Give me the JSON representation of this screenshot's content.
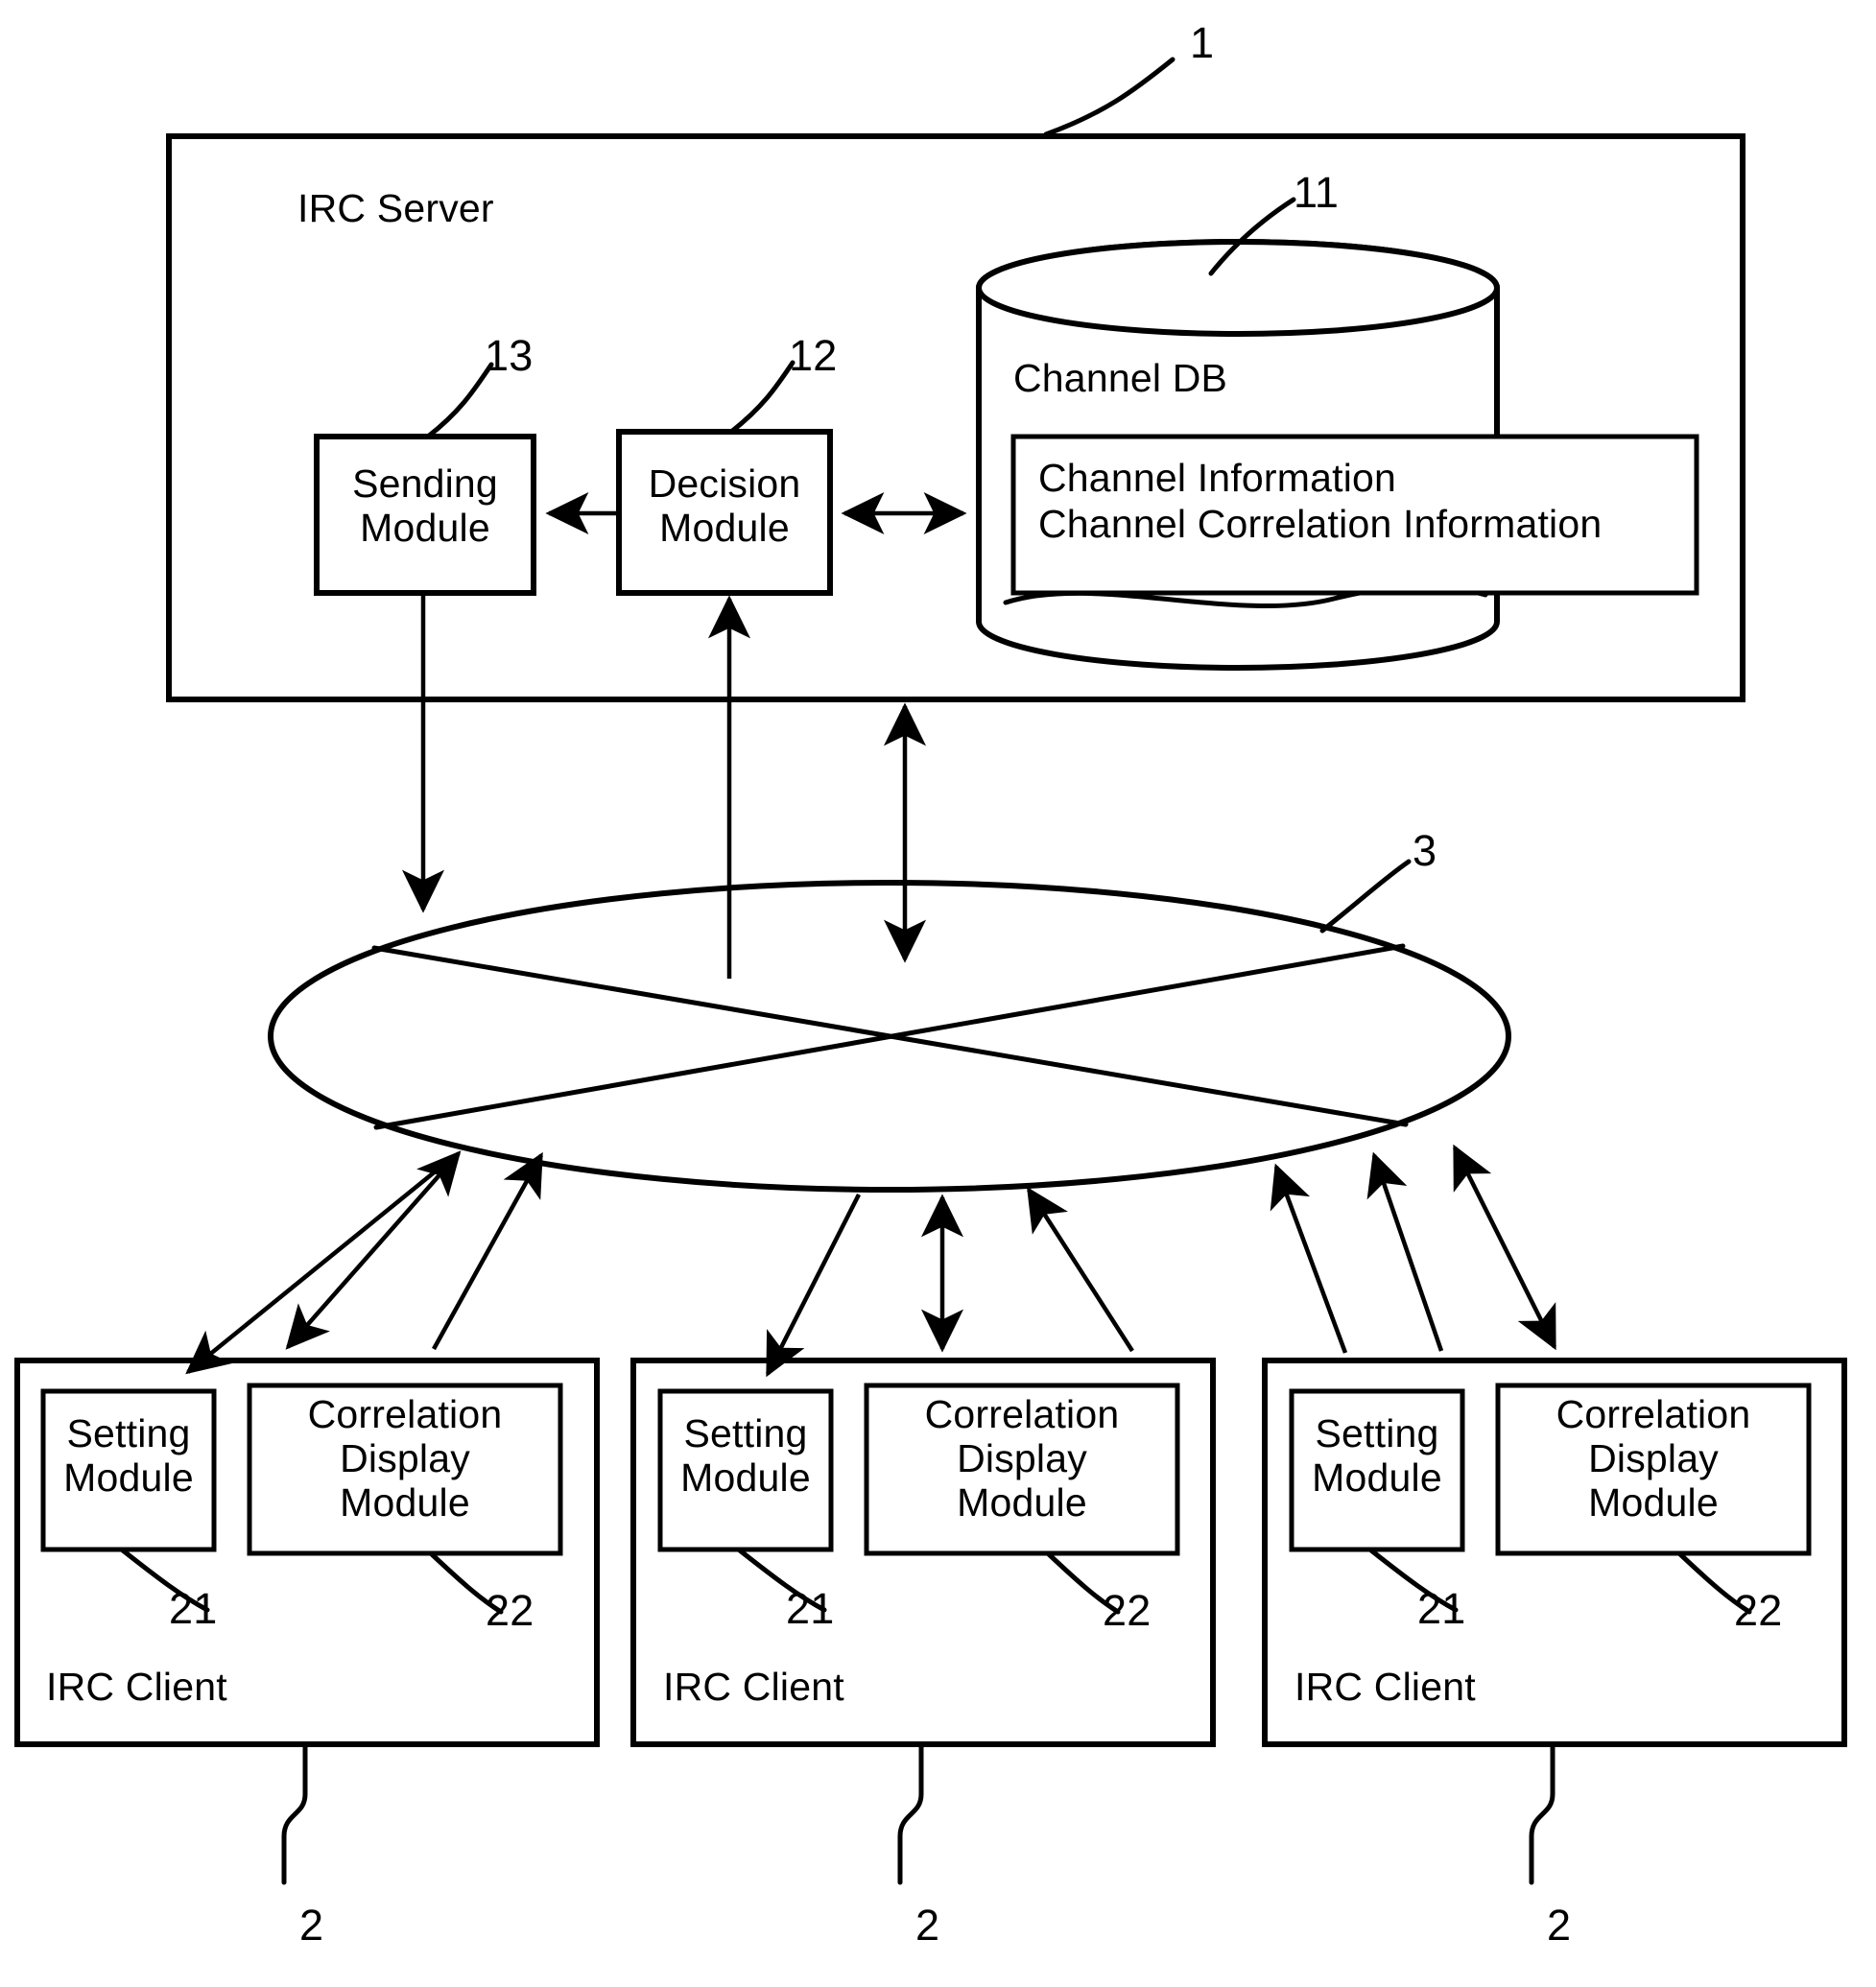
{
  "figure": {
    "server": {
      "label": "IRC Server",
      "ref": "1",
      "sending_module": {
        "line1": "Sending",
        "line2": "Module",
        "ref": "13"
      },
      "decision_module": {
        "line1": "Decision",
        "line2": "Module",
        "ref": "12"
      },
      "channel_db": {
        "label": "Channel DB",
        "ref": "11",
        "info_line1": "Channel Information",
        "info_line2": "Channel Correlation Information"
      }
    },
    "network": {
      "ref": "3"
    },
    "clients": [
      {
        "label": "IRC Client",
        "ref": "2",
        "setting_module": {
          "line1": "Setting",
          "line2": "Module",
          "ref": "21"
        },
        "correlation_display_module": {
          "line1": "Correlation",
          "line2": "Display",
          "line3": "Module",
          "ref": "22"
        }
      },
      {
        "label": "IRC Client",
        "ref": "2",
        "setting_module": {
          "line1": "Setting",
          "line2": "Module",
          "ref": "21"
        },
        "correlation_display_module": {
          "line1": "Correlation",
          "line2": "Display",
          "line3": "Module",
          "ref": "22"
        }
      },
      {
        "label": "IRC Client",
        "ref": "2",
        "setting_module": {
          "line1": "Setting",
          "line2": "Module",
          "ref": "21"
        },
        "correlation_display_module": {
          "line1": "Correlation",
          "line2": "Display",
          "line3": "Module",
          "ref": "22"
        }
      }
    ],
    "colors": {
      "ink": "#000000",
      "paper": "#ffffff"
    }
  }
}
